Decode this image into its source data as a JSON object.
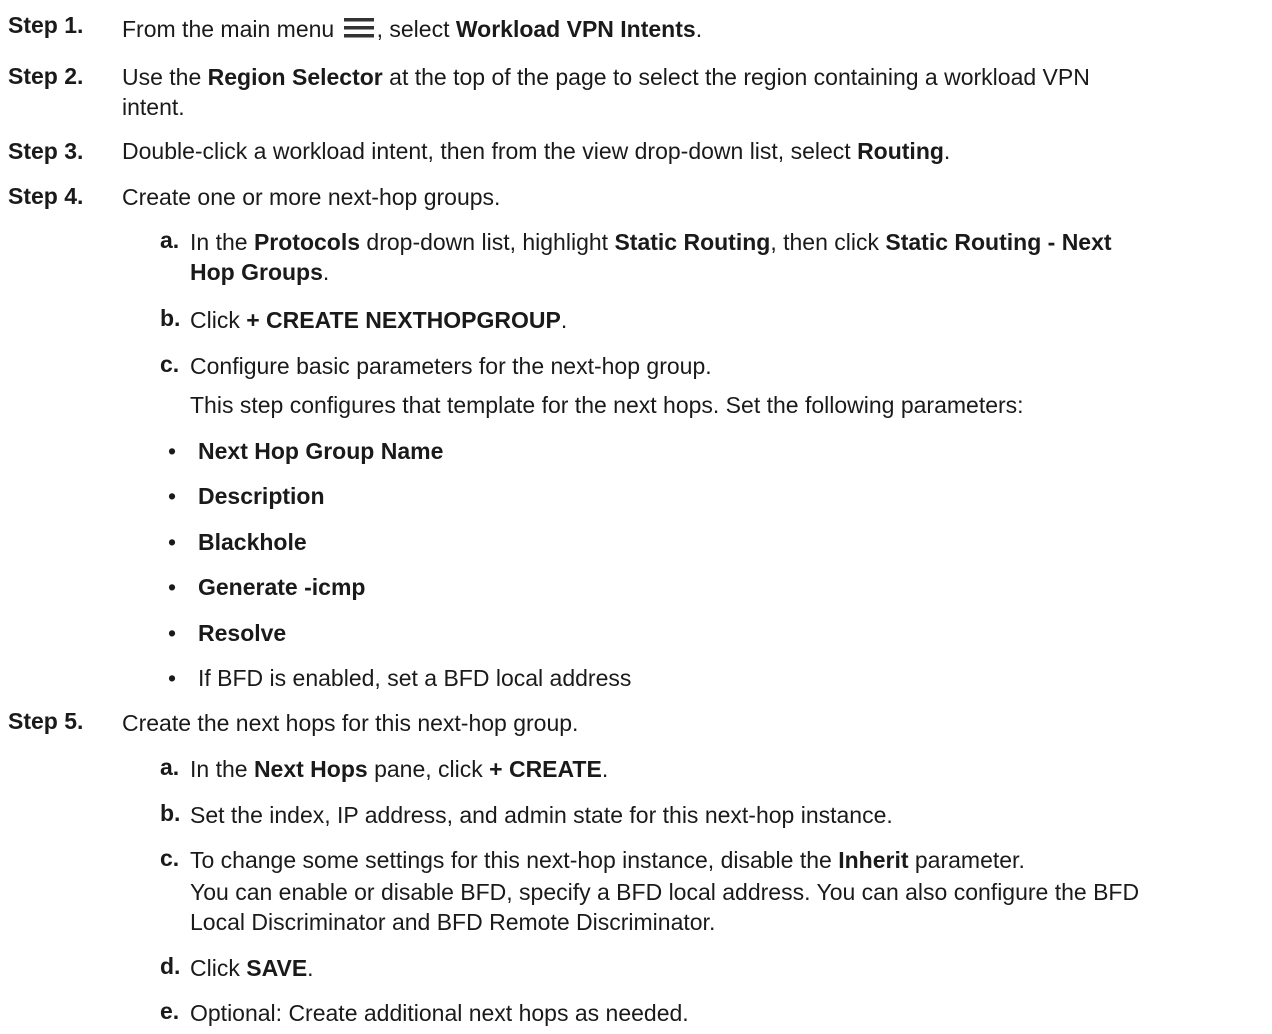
{
  "steps": [
    {
      "label": "Step 1.",
      "parts": [
        "From the main menu ",
        "",
        ", select ",
        "Workload VPN Intents",
        "."
      ]
    },
    {
      "label": "Step 2.",
      "parts": [
        "Use the ",
        "Region Selector",
        " at the top of the page to select the region containing a workload VPN"
      ],
      "cont": "intent."
    },
    {
      "label": "Step 3.",
      "parts": [
        "Double-click a workload intent, then from the view drop-down list, select ",
        "Routing",
        "."
      ]
    },
    {
      "label": "Step 4.",
      "text": "Create one or more next-hop groups."
    },
    {
      "label": "Step 5.",
      "text": "Create the next hops for this next-hop group."
    }
  ],
  "step4_subs": [
    {
      "letter": "a.",
      "parts": [
        "In the ",
        "Protocols",
        " drop-down list, highlight ",
        "Static Routing",
        ", then click ",
        "Static Routing - Next"
      ],
      "cont_bold": "Hop Groups",
      "cont_tail": "."
    },
    {
      "letter": "b.",
      "parts": [
        "Click ",
        "+ CREATE NEXTHOPGROUP",
        "."
      ]
    },
    {
      "letter": "c.",
      "text": "Configure basic parameters for the next-hop group.",
      "note": "This step configures that template for the next hops. Set the following parameters:"
    }
  ],
  "bullets": [
    "Next Hop Group Name",
    "Description",
    "Blackhole",
    "Generate -icmp",
    "Resolve",
    "If BFD is enabled, set a BFD local address"
  ],
  "bullet_char": "•",
  "step5_subs": [
    {
      "letter": "a.",
      "parts": [
        "In the ",
        "Next Hops",
        " pane, click ",
        "+ CREATE",
        "."
      ]
    },
    {
      "letter": "b.",
      "text": "Set the index, IP address, and admin state for this next-hop instance."
    },
    {
      "letter": "c.",
      "parts": [
        "To change some settings for this next-hop instance, disable the ",
        "Inherit",
        " parameter."
      ],
      "note1": "You can enable or disable BFD, specify a BFD local address. You can also configure the BFD",
      "note2": "Local Discriminator and BFD Remote Discriminator."
    },
    {
      "letter": "d.",
      "parts": [
        "Click ",
        "SAVE",
        "."
      ]
    },
    {
      "letter": "e.",
      "text": "Optional: Create additional next hops as needed."
    }
  ],
  "icons": {
    "menu": "hamburger-menu-icon"
  }
}
